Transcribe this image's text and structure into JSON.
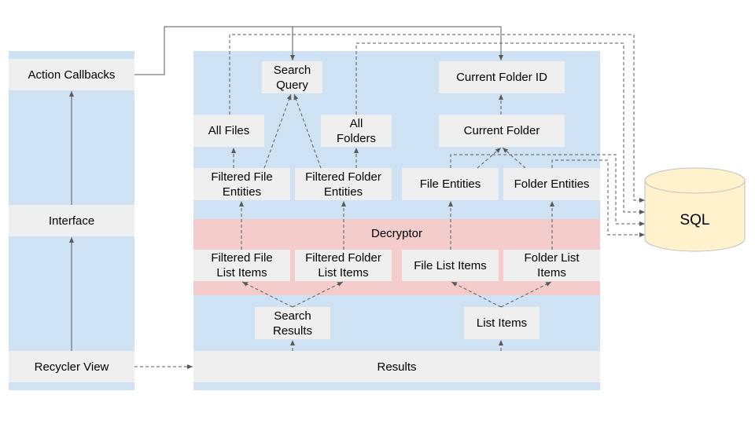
{
  "left_column": {
    "action_callbacks": "Action Callbacks",
    "interface": "Interface",
    "recycler_view": "Recycler View"
  },
  "main": {
    "search_query": "Search Query",
    "all_files": "All Files",
    "all_folders": "All Folders",
    "filtered_file_entities": "Filtered File Entities",
    "filtered_folder_entities": "Filtered Folder Entities",
    "current_folder_id": "Current Folder ID",
    "current_folder": "Current Folder",
    "file_entities": "File Entities",
    "folder_entities": "Folder Entities",
    "decryptor": "Decryptor",
    "filtered_file_list_items": "Filtered File List Items",
    "filtered_folder_list_items": "Filtered Folder List Items",
    "file_list_items": "File List Items",
    "folder_list_items": "Folder List Items",
    "search_results": "Search Results",
    "list_items": "List Items",
    "results": "Results"
  },
  "database": {
    "label": "SQL"
  },
  "colors": {
    "panel": "#cfe2f3",
    "decryptor_band": "#f4cccc",
    "box": "#efefef",
    "database": "#fff2cc",
    "line": "#595959"
  }
}
